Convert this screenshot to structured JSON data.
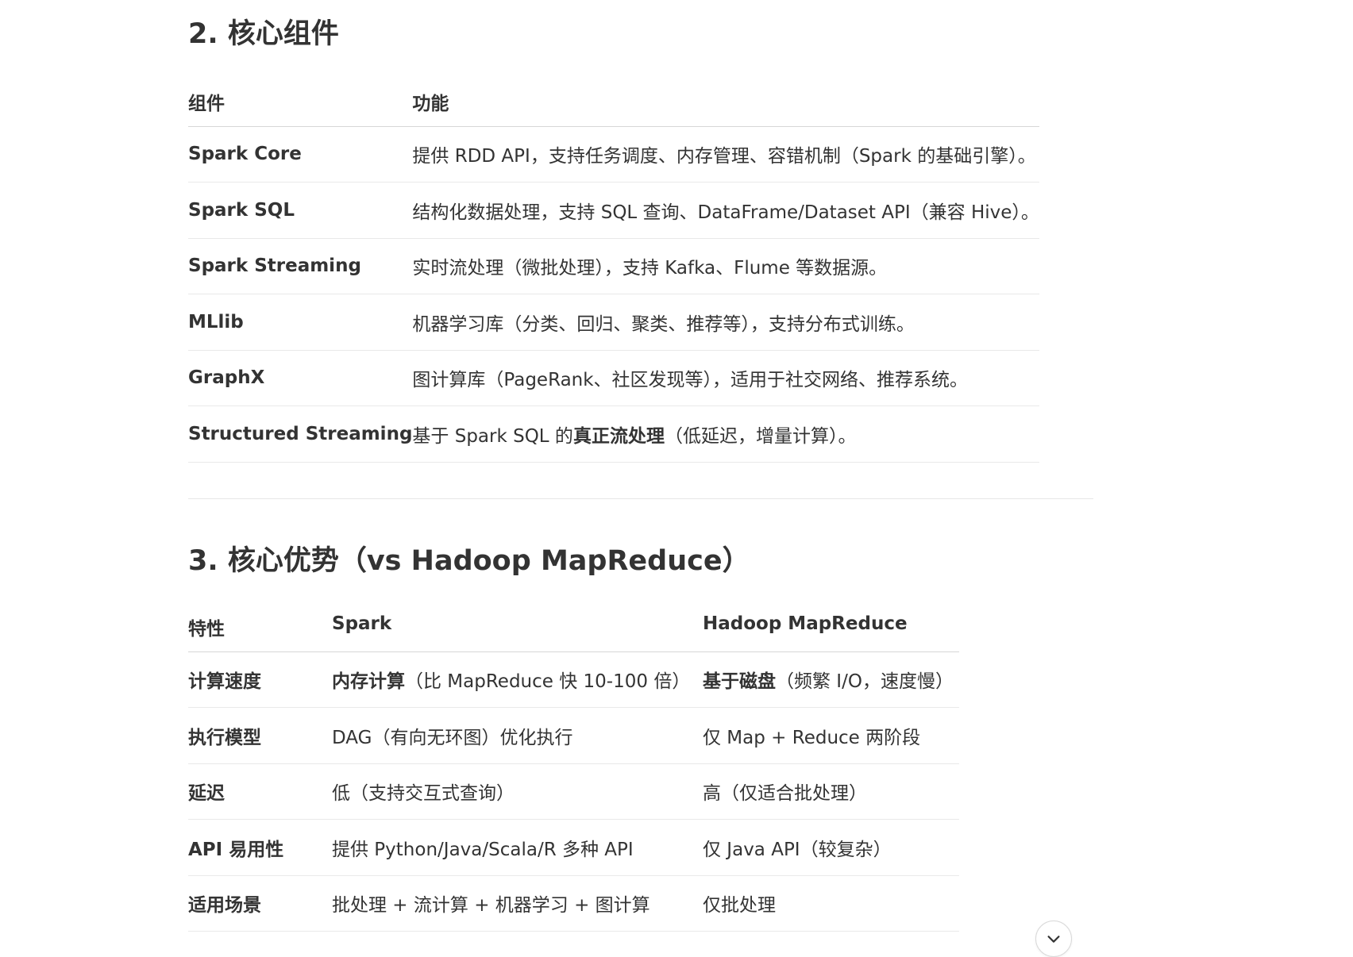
{
  "section2": {
    "title": "2. 核心组件",
    "table": {
      "headers": [
        "组件",
        "功能"
      ],
      "rows": [
        {
          "name": "Spark Core",
          "desc": [
            {
              "t": "提供 RDD API，支持任务调度、内存管理、容错机制（Spark 的基础引擎）。",
              "b": false
            }
          ]
        },
        {
          "name": "Spark SQL",
          "desc": [
            {
              "t": "结构化数据处理，支持 SQL 查询、DataFrame/Dataset API（兼容 Hive）。",
              "b": false
            }
          ]
        },
        {
          "name": "Spark Streaming",
          "desc": [
            {
              "t": "实时流处理（微批处理），支持 Kafka、Flume 等数据源。",
              "b": false
            }
          ]
        },
        {
          "name": "MLlib",
          "desc": [
            {
              "t": "机器学习库（分类、回归、聚类、推荐等），支持分布式训练。",
              "b": false
            }
          ]
        },
        {
          "name": "GraphX",
          "desc": [
            {
              "t": "图计算库（PageRank、社区发现等），适用于社交网络、推荐系统。",
              "b": false
            }
          ]
        },
        {
          "name": "Structured Streaming",
          "desc": [
            {
              "t": "基于 Spark SQL 的",
              "b": false
            },
            {
              "t": "真正流处理",
              "b": true
            },
            {
              "t": "（低延迟，增量计算）。",
              "b": false
            }
          ]
        }
      ]
    }
  },
  "section3": {
    "title": "3. 核心优势（vs Hadoop MapReduce）",
    "table": {
      "headers": [
        "特性",
        "Spark",
        "Hadoop MapReduce"
      ],
      "rows": [
        {
          "feature": "计算速度",
          "spark": [
            {
              "t": "内存计算",
              "b": true
            },
            {
              "t": "（比 MapReduce 快 10-100 倍）",
              "b": false
            }
          ],
          "hadoop": [
            {
              "t": "基于磁盘",
              "b": true
            },
            {
              "t": "（频繁 I/O，速度慢）",
              "b": false
            }
          ]
        },
        {
          "feature": "执行模型",
          "spark": [
            {
              "t": "DAG（有向无环图）优化执行",
              "b": false
            }
          ],
          "hadoop": [
            {
              "t": "仅 Map + Reduce 两阶段",
              "b": false
            }
          ]
        },
        {
          "feature": "延迟",
          "spark": [
            {
              "t": "低（支持交互式查询）",
              "b": false
            }
          ],
          "hadoop": [
            {
              "t": "高（仅适合批处理）",
              "b": false
            }
          ]
        },
        {
          "feature": "API 易用性",
          "spark": [
            {
              "t": "提供 Python/Java/Scala/R 多种 API",
              "b": false
            }
          ],
          "hadoop": [
            {
              "t": "仅 Java API（较复杂）",
              "b": false
            }
          ]
        },
        {
          "feature": "适用场景",
          "spark": [
            {
              "t": "批处理 + 流计算 + 机器学习 + 图计算",
              "b": false
            }
          ],
          "hadoop": [
            {
              "t": "仅批处理",
              "b": false
            }
          ]
        }
      ]
    }
  },
  "scroll_button": {
    "icon": "chevron-down-icon"
  }
}
